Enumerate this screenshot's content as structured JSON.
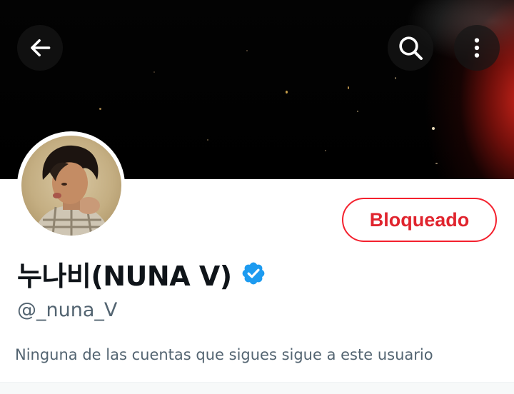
{
  "header": {
    "back_icon": "arrow-left-icon",
    "search_icon": "search-icon",
    "more_icon": "more-vertical-icon"
  },
  "profile": {
    "display_name": "누나비(NUNA V)",
    "verified": true,
    "verified_badge_color": "#1d9bf0",
    "handle": "@_nuna_V",
    "action_button_label": "Bloqueado",
    "action_button_color": "#f4212e",
    "followers_note": "Ninguna de las cuentas que sigues sigue a este usuario"
  },
  "colors": {
    "text_primary": "#0f1419",
    "text_secondary": "#536471",
    "banner_accent": "#d6261c"
  }
}
